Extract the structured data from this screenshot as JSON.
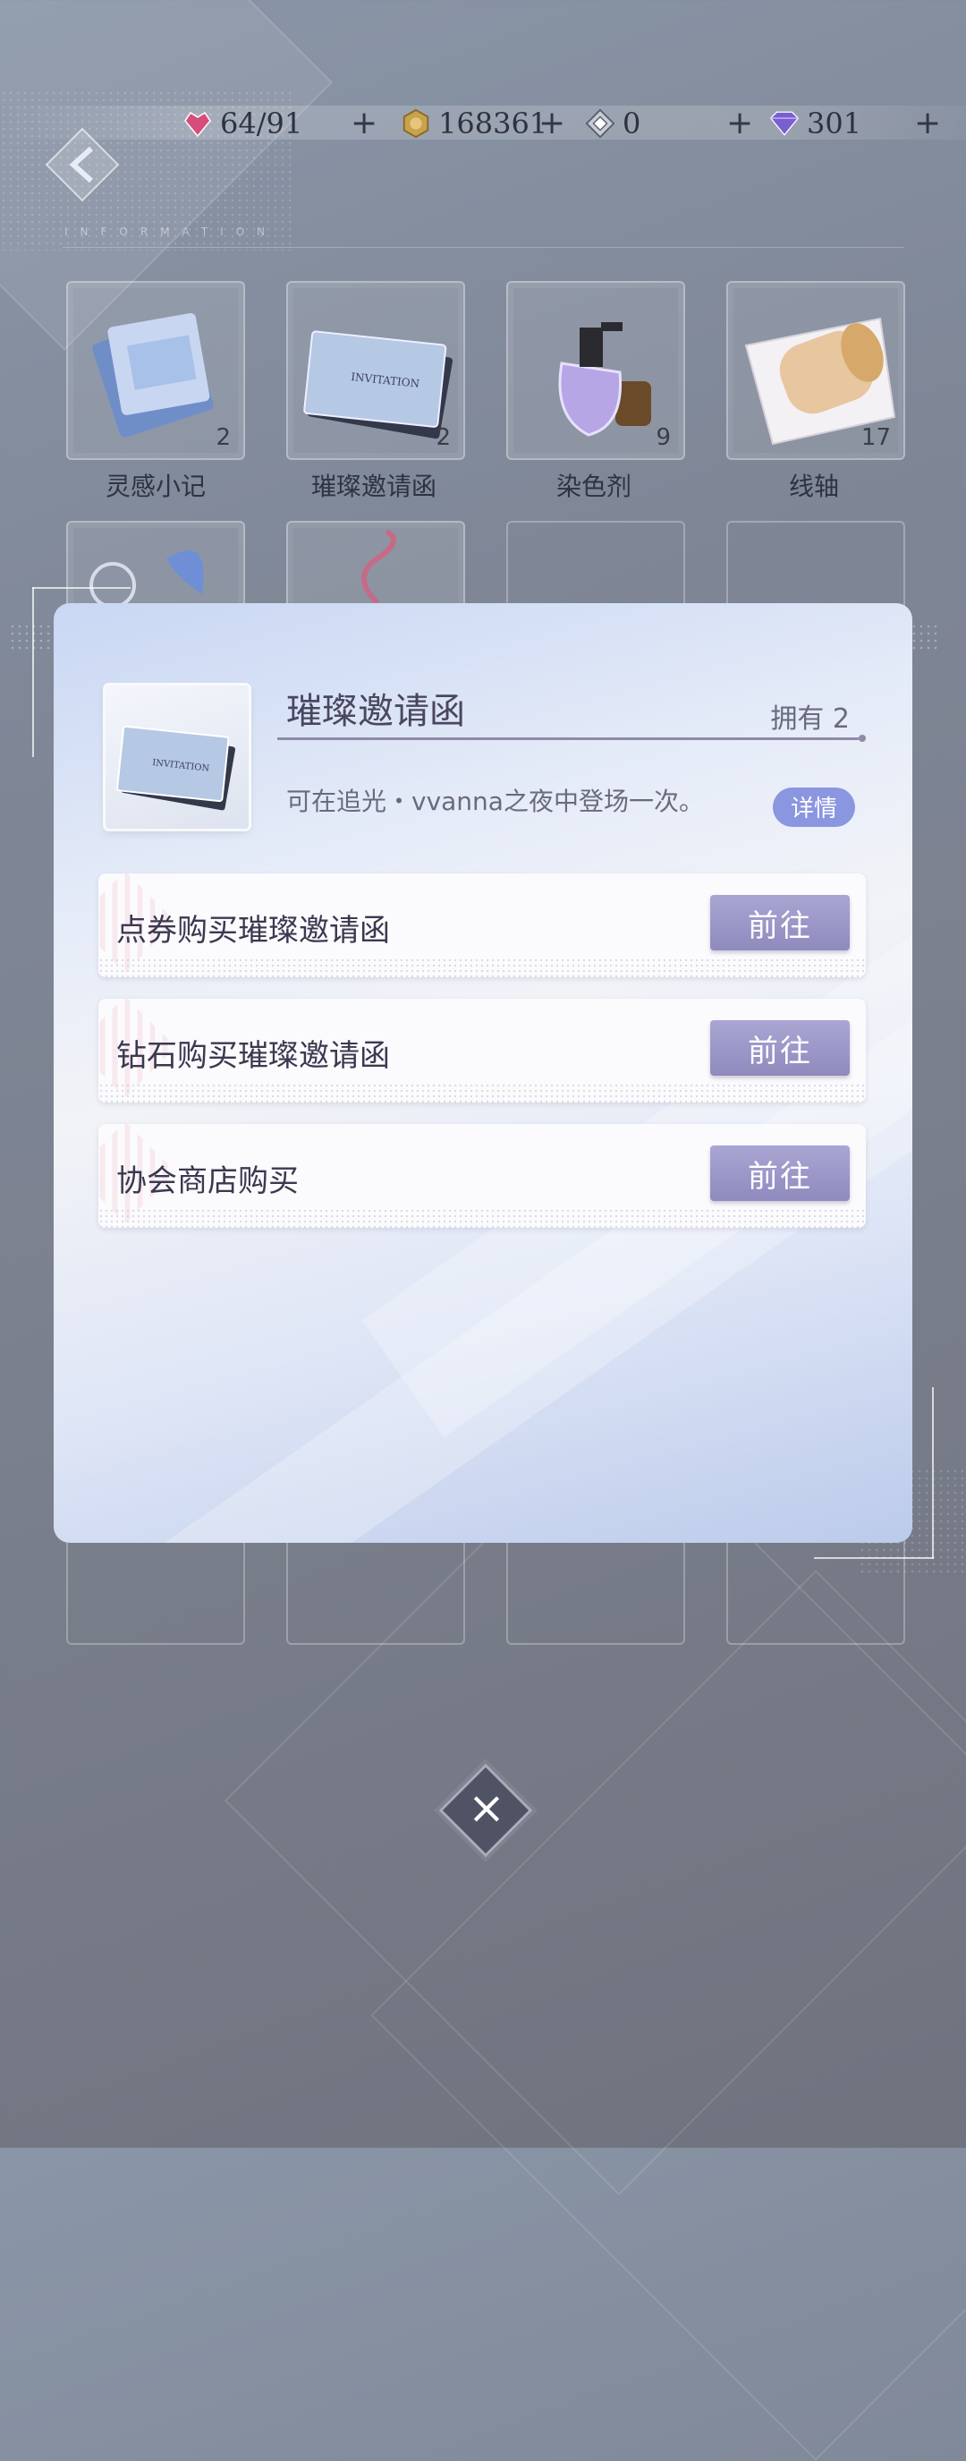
{
  "currencies": [
    {
      "name": "stamina",
      "icon": "heart-gem-icon",
      "value": "64/91",
      "color": "#d64d7a"
    },
    {
      "name": "coins",
      "icon": "gold-coin-icon",
      "value": "168361",
      "color": "#c9a24f"
    },
    {
      "name": "tokens",
      "icon": "diamond-token-icon",
      "value": "0",
      "color": "#8a8fa0"
    },
    {
      "name": "diamonds",
      "icon": "purple-diamond-icon",
      "value": "301",
      "color": "#7a5fd0"
    }
  ],
  "plus_label": "+",
  "inventory": [
    {
      "label": "灵感小记",
      "count": "2",
      "icon": "notebook-icon"
    },
    {
      "label": "璀璨邀请函",
      "count": "2",
      "icon": "invitation-card-icon"
    },
    {
      "label": "染色剂",
      "count": "9",
      "icon": "dye-bottle-icon"
    },
    {
      "label": "线轴",
      "count": "17",
      "icon": "thread-spool-icon"
    }
  ],
  "dialog": {
    "item_name": "璀璨邀请函",
    "owned": "拥有 2",
    "description": "可在追光・vvanna之夜中登场一次。",
    "detail_label": "详情",
    "options": [
      {
        "label": "点券购买璀璨邀请函",
        "button": "前往"
      },
      {
        "label": "钻石购买璀璨邀请函",
        "button": "前往"
      },
      {
        "label": "协会商店购买",
        "button": "前往"
      }
    ]
  },
  "close_label": "×"
}
